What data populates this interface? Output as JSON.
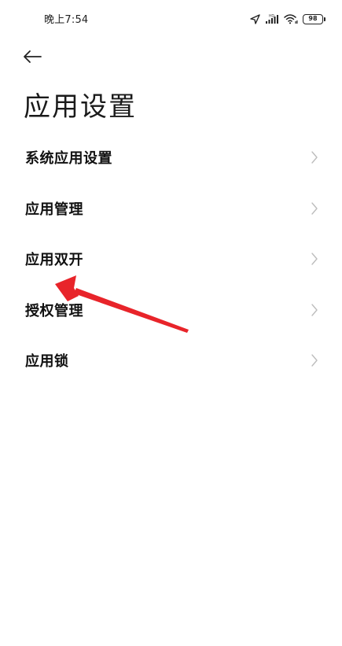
{
  "status_bar": {
    "time": "晚上7:54",
    "battery": "98",
    "icons": [
      "location-icon",
      "signal-icon",
      "wifi-icon",
      "battery-icon"
    ]
  },
  "header": {
    "back_icon": "back-arrow-icon",
    "title": "应用设置"
  },
  "menu": {
    "items": [
      {
        "label": "系统应用设置"
      },
      {
        "label": "应用管理"
      },
      {
        "label": "应用双开"
      },
      {
        "label": "授权管理"
      },
      {
        "label": "应用锁"
      }
    ]
  },
  "annotation": {
    "color": "#e8242a",
    "icon": "red-arrow-annotation"
  },
  "colors": {
    "text": "#111111",
    "chevron": "#bdbdbd",
    "background": "#ffffff"
  }
}
